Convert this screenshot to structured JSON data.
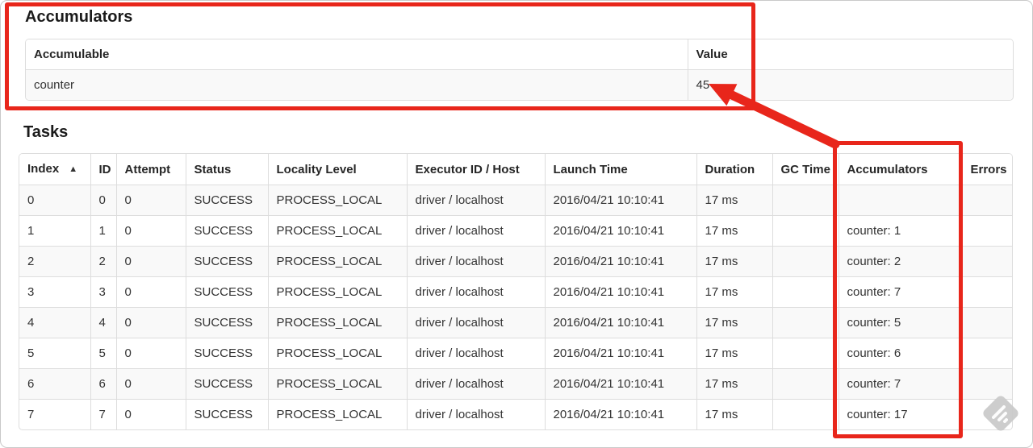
{
  "accumulators_section": {
    "title": "Accumulators",
    "table": {
      "headers": [
        "Accumulable",
        "Value"
      ],
      "rows": [
        [
          "counter",
          "45"
        ]
      ]
    }
  },
  "tasks_section": {
    "title": "Tasks",
    "table": {
      "headers": [
        "Index",
        "ID",
        "Attempt",
        "Status",
        "Locality Level",
        "Executor ID / Host",
        "Launch Time",
        "Duration",
        "GC Time",
        "Accumulators",
        "Errors"
      ],
      "sort_indicator": "▲",
      "rows": [
        [
          "0",
          "0",
          "0",
          "SUCCESS",
          "PROCESS_LOCAL",
          "driver / localhost",
          "2016/04/21 10:10:41",
          "17 ms",
          "",
          "",
          ""
        ],
        [
          "1",
          "1",
          "0",
          "SUCCESS",
          "PROCESS_LOCAL",
          "driver / localhost",
          "2016/04/21 10:10:41",
          "17 ms",
          "",
          "counter: 1",
          ""
        ],
        [
          "2",
          "2",
          "0",
          "SUCCESS",
          "PROCESS_LOCAL",
          "driver / localhost",
          "2016/04/21 10:10:41",
          "17 ms",
          "",
          "counter: 2",
          ""
        ],
        [
          "3",
          "3",
          "0",
          "SUCCESS",
          "PROCESS_LOCAL",
          "driver / localhost",
          "2016/04/21 10:10:41",
          "17 ms",
          "",
          "counter: 7",
          ""
        ],
        [
          "4",
          "4",
          "0",
          "SUCCESS",
          "PROCESS_LOCAL",
          "driver / localhost",
          "2016/04/21 10:10:41",
          "17 ms",
          "",
          "counter: 5",
          ""
        ],
        [
          "5",
          "5",
          "0",
          "SUCCESS",
          "PROCESS_LOCAL",
          "driver / localhost",
          "2016/04/21 10:10:41",
          "17 ms",
          "",
          "counter: 6",
          ""
        ],
        [
          "6",
          "6",
          "0",
          "SUCCESS",
          "PROCESS_LOCAL",
          "driver / localhost",
          "2016/04/21 10:10:41",
          "17 ms",
          "",
          "counter: 7",
          ""
        ],
        [
          "7",
          "7",
          "0",
          "SUCCESS",
          "PROCESS_LOCAL",
          "driver / localhost",
          "2016/04/21 10:10:41",
          "17 ms",
          "",
          "counter: 17",
          ""
        ]
      ]
    }
  },
  "annotations": {
    "highlight_color": "#e8261b",
    "watermark_color": "#c9c9c9"
  }
}
